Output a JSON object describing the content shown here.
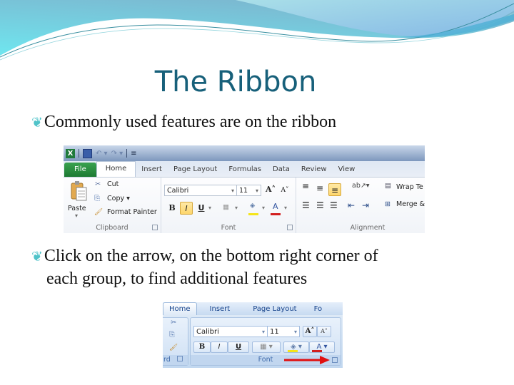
{
  "slide": {
    "title": "The Ribbon",
    "bullet_icon": "swirl-bullet-icon",
    "bullets": [
      {
        "mark": "❦",
        "text": "Commonly used features are on the ribbon"
      },
      {
        "mark": "❦",
        "line1": "Click on the arrow, on the bottom right corner of",
        "line2": "each group, to find additional features"
      }
    ],
    "colors": {
      "title": "#17607a",
      "bullet_mark": "#4fc3c9",
      "banner_light": "#7ce5ee",
      "banner_dark": "#79b4cd"
    }
  },
  "ribbon_2010": {
    "quick_access": {
      "app_icon": "X",
      "icons": [
        "excel-icon",
        "save-icon",
        "undo-icon",
        "redo-icon",
        "customize-qat-icon"
      ],
      "undo": "↶ ▾",
      "redo": "↷ ▾",
      "customize": "≡"
    },
    "tabs": [
      "File",
      "Home",
      "Insert",
      "Page Layout",
      "Formulas",
      "Data",
      "Review",
      "View"
    ],
    "active_tab": "Home",
    "clipboard": {
      "label": "Clipboard",
      "paste": "Paste",
      "paste_arrow": "▾",
      "cut": "Cut",
      "copy": "Copy ▾",
      "format_painter": "Format Painter"
    },
    "font": {
      "label": "Font",
      "font_name": "Calibri",
      "font_size": "11",
      "grow": "A˄",
      "shrink": "A˅",
      "bold": "B",
      "italic": "I",
      "underline": "U",
      "dropdown": "▾",
      "fill_color": "#f5e51a",
      "font_color": "#d21f1f"
    },
    "alignment": {
      "label": "Alignment",
      "wrap_text": "Wrap Te",
      "merge": "Merge &"
    }
  },
  "ribbon_2007": {
    "tabs": [
      "Home",
      "Insert",
      "Page Layout",
      "Fo"
    ],
    "active_tab": "Home",
    "clipboard_label": "rd",
    "font": {
      "label": "Font",
      "font_name": "Calibri",
      "font_size": "11",
      "grow": "A˄",
      "shrink": "A˅",
      "bold": "B",
      "italic": "I",
      "underline": "U",
      "dropdown": "▾",
      "fill_color": "#f5e51a",
      "font_color": "#d21f1f"
    },
    "annotation_arrow_color": "#e01010"
  }
}
